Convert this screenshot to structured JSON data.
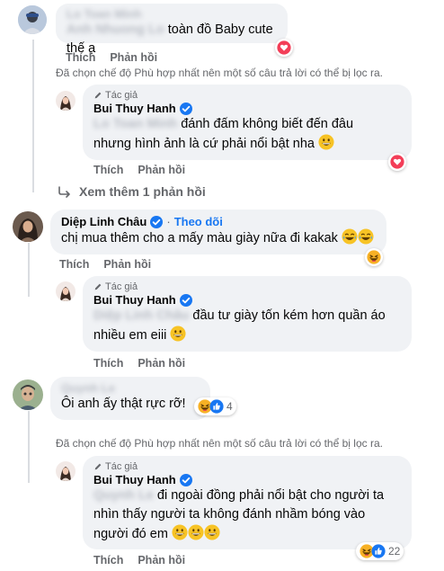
{
  "comments": {
    "c1": {
      "name": "Lo Toan Minh",
      "mention": "Anh Nhuong Lo",
      "text": "toàn đồ Baby cute thế ạ"
    },
    "c1_reply": {
      "tag": "Tác giả",
      "name": "Bui Thuy Hanh",
      "mention": "Lo Toan Minh",
      "text_line1": "đánh đấm không biết đến đâu",
      "text_line2": "nhưng hình ảnh là cứ phải nổi bật nha"
    },
    "more_replies": "Xem thêm 1 phản hồi",
    "c2": {
      "name": "Diệp Linh Châu",
      "follow": "Theo dõi",
      "text": "chị mua thêm cho a mấy màu giày nữa đi kakak"
    },
    "c2_reply": {
      "tag": "Tác giả",
      "name": "Bui Thuy Hanh",
      "mention": "Diệp Linh Châu",
      "text_line1": "đầu tư giày tốn kém hơn quần áo",
      "text_line2": "nhiều em eiii"
    },
    "c3": {
      "name": "Quynh Le",
      "text": "Ôi anh ấy thật rực rỡ!",
      "reaction_count": "4"
    },
    "c3_reply": {
      "tag": "Tác giả",
      "name": "Bui Thuy Hanh",
      "mention": "Quynh Le",
      "text_line1": "đi ngoài đồng phải nổi bật cho người ta",
      "text_line2": "nhìn thấy người ta không đánh nhầm bóng vào",
      "text_line3": "người đó em",
      "reaction_count": "22"
    }
  },
  "actions": {
    "like": "Thích",
    "reply": "Phản hồi"
  },
  "filter_note": "Đã chọn chế độ Phù hợp nhất nên một số câu trả lời có thể bị lọc ra.",
  "colors": {
    "accent": "#1877f2",
    "bubble": "#f0f2f5",
    "muted": "#65676b",
    "love": "#f33e58",
    "haha": "#f7b125"
  },
  "icons": [
    "verified-badge-icon",
    "author-pen-icon",
    "reply-arrow-icon",
    "heart-reaction-icon",
    "haha-emoji-icon",
    "like-reaction-icon",
    "grin-emoji-icon"
  ]
}
